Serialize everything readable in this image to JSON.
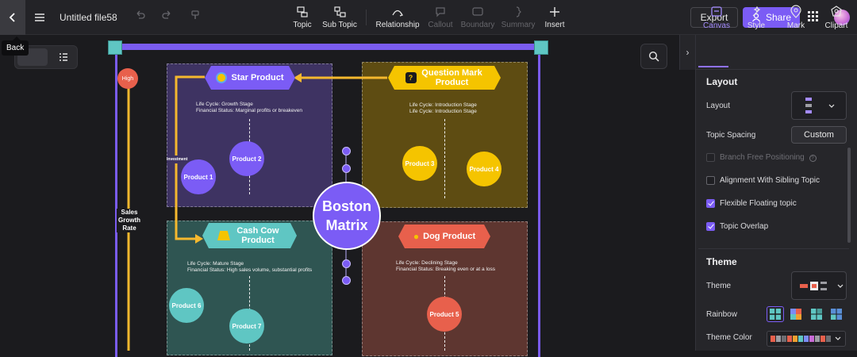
{
  "header": {
    "file_name": "Untitled file58",
    "back_tooltip": "Back",
    "tools": [
      {
        "label": "Topic",
        "enabled": true
      },
      {
        "label": "Sub Topic",
        "enabled": true
      },
      {
        "label": "Relationship",
        "enabled": true
      },
      {
        "label": "Callout",
        "enabled": false
      },
      {
        "label": "Boundary",
        "enabled": false
      },
      {
        "label": "Summary",
        "enabled": false
      },
      {
        "label": "Insert",
        "enabled": true
      }
    ],
    "export_label": "Export",
    "share_label": "Share"
  },
  "diagram": {
    "center_title": "Boston Matrix",
    "axis_high": "High",
    "axis_label": "Sales Growth Rate",
    "investment_label": "Investment",
    "star": {
      "title": "Star Product",
      "life_cycle": "Life Cycle: Growth Stage",
      "financial": "Financial Status: Marginal profits or breakeven",
      "products": [
        "Product 2",
        "Product 1"
      ]
    },
    "question": {
      "title": "Question Mark Product",
      "life_cycle": "Life Cycle: Introduction Stage",
      "financial": "Life Cycle: Introduction Stage",
      "products": [
        "Product 3",
        "Product 4"
      ]
    },
    "cashcow": {
      "title": "Cash Cow Product",
      "life_cycle": "Life Cycle: Mature Stage",
      "financial": "Financial Status: High sales volume, substantial profits",
      "products": [
        "Product 6",
        "Product 7"
      ]
    },
    "dog": {
      "title": "Dog Product",
      "life_cycle": "Life Cycle: Declining Stage",
      "financial": "Financial Status: Breaking even or at a loss",
      "products": [
        "Product 5"
      ]
    },
    "colors": {
      "frame": "#7a5cf0",
      "star_bg": "#3e3362",
      "question_bg": "#5e4c12",
      "cashcow_bg": "#2f5552",
      "dog_bg": "#5e3630",
      "purple": "#7b5cf5",
      "yellow": "#f5c400",
      "teal": "#5fc6c3",
      "orange": "#e8604c",
      "arrow": "#f5b82e"
    }
  },
  "panel": {
    "tabs": [
      {
        "label": "Canvas",
        "active": true
      },
      {
        "label": "Style",
        "active": false
      },
      {
        "label": "Mark",
        "active": false
      },
      {
        "label": "Clipart",
        "active": false
      }
    ],
    "layout_section": "Layout",
    "layout_label": "Layout",
    "topic_spacing_label": "Topic Spacing",
    "custom_label": "Custom",
    "checkboxes": [
      {
        "label": "Branch Free Positioning",
        "checked": false,
        "enabled": false
      },
      {
        "label": "Alignment With Sibling Topic",
        "checked": false,
        "enabled": true
      },
      {
        "label": "Flexible Floating topic",
        "checked": true,
        "enabled": true
      },
      {
        "label": "Topic Overlap",
        "checked": true,
        "enabled": true
      }
    ],
    "theme_section": "Theme",
    "theme_label": "Theme",
    "rainbow_label": "Rainbow",
    "theme_color_label": "Theme Color",
    "theme_colors": [
      "#e8604c",
      "#9d9da3",
      "#6d6d72",
      "#e8604c",
      "#f0a030",
      "#5fc6c3",
      "#7b8cf5",
      "#c86ad6",
      "#9d9da3",
      "#e8604c",
      "#6d6d72"
    ]
  }
}
